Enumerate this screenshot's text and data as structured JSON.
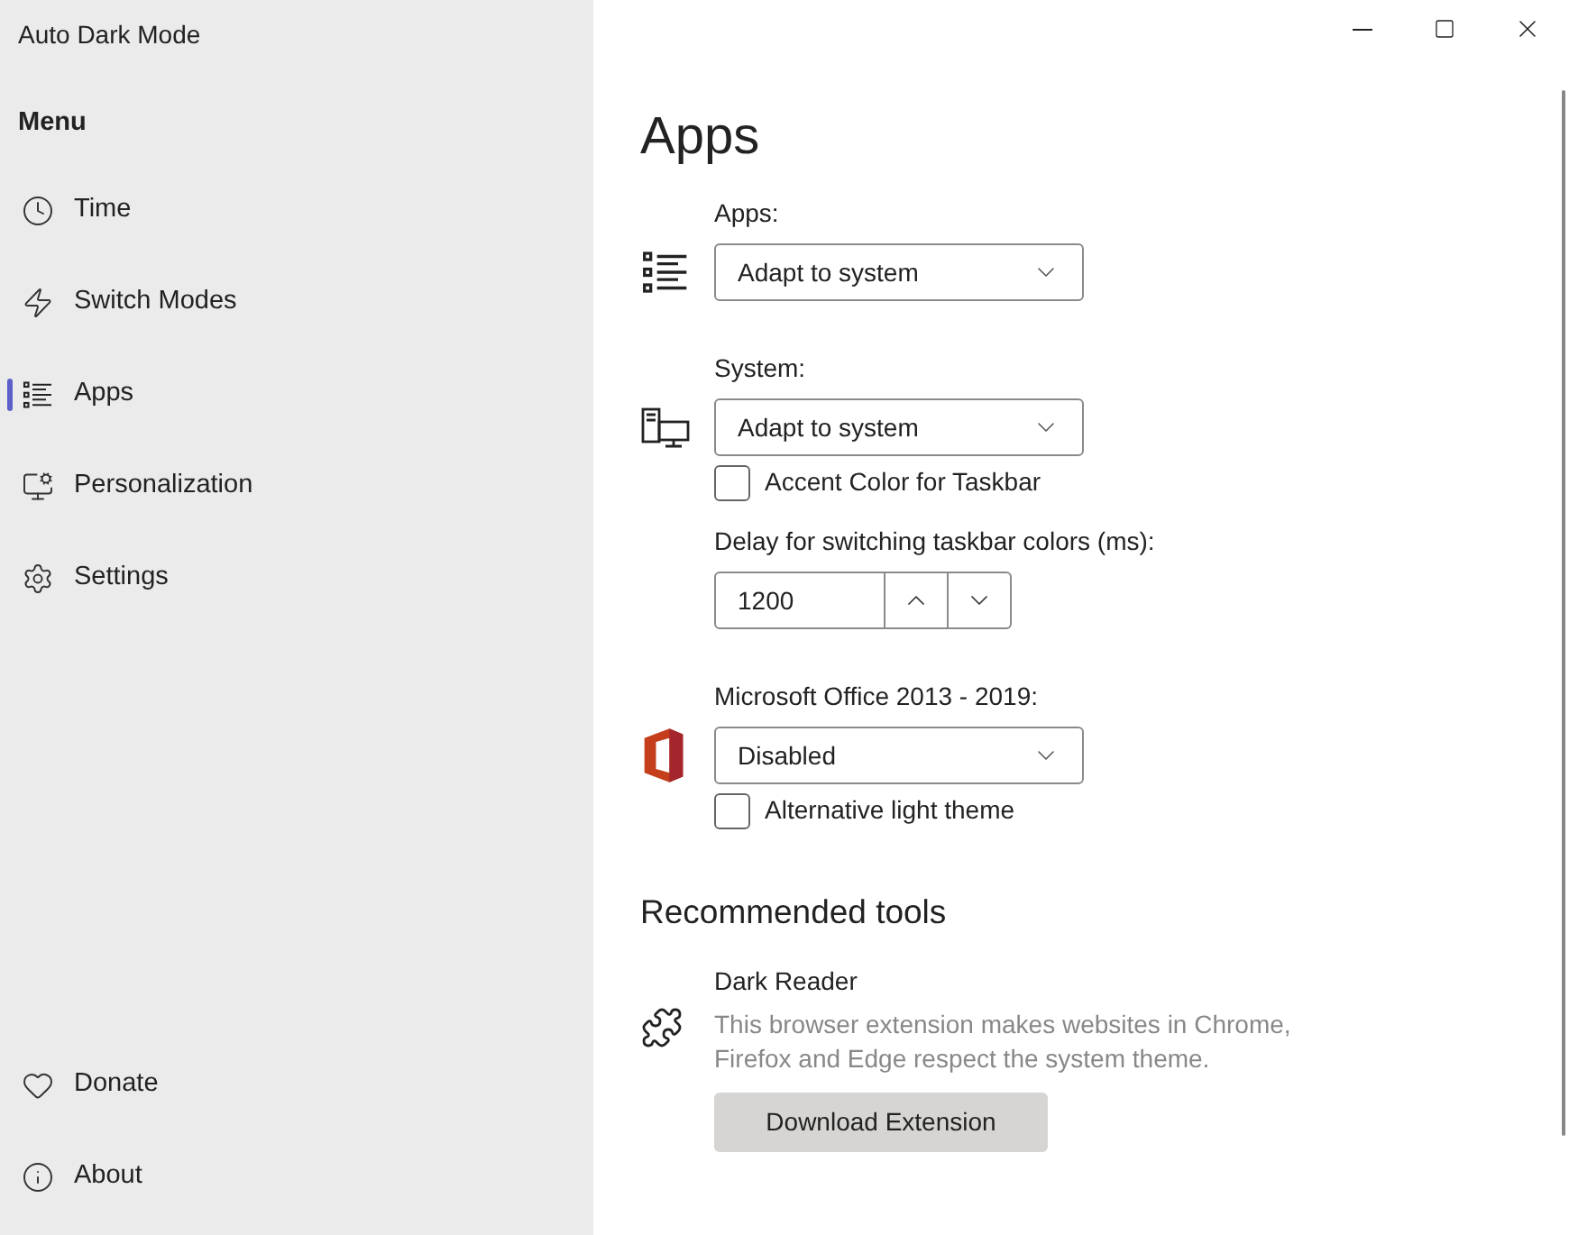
{
  "window": {
    "title": "Auto Dark Mode"
  },
  "sidebar": {
    "heading": "Menu",
    "items": [
      {
        "kind": "clock",
        "label": "Time",
        "selected": false
      },
      {
        "kind": "bolt",
        "label": "Switch Modes",
        "selected": false
      },
      {
        "kind": "list",
        "label": "Apps",
        "selected": true
      },
      {
        "kind": "brush",
        "label": "Personalization",
        "selected": false
      },
      {
        "kind": "gear",
        "label": "Settings",
        "selected": false
      }
    ],
    "footer_items": [
      {
        "kind": "heart",
        "label": "Donate",
        "selected": false
      },
      {
        "kind": "info",
        "label": "About",
        "selected": false
      }
    ]
  },
  "page": {
    "title": "Apps",
    "sections": [
      {
        "kind": "list",
        "label": "Apps:",
        "dropdown": "Adapt to system"
      },
      {
        "kind": "pc",
        "label": "System:",
        "dropdown": "Adapt to system",
        "checkbox": {
          "label": "Accent Color for Taskbar",
          "checked": false
        },
        "spinner": {
          "label": "Delay for switching taskbar colors (ms):",
          "value": "1200"
        }
      },
      {
        "kind": "office",
        "label": "Microsoft Office 2013 - 2019:",
        "dropdown": "Disabled",
        "checkbox": {
          "label": "Alternative light theme",
          "checked": false
        }
      }
    ],
    "recommended": {
      "heading": "Recommended tools",
      "name": "Dark Reader",
      "description": "This browser extension makes websites in Chrome, Firefox and Edge respect the system theme.",
      "button": "Download Extension"
    }
  }
}
